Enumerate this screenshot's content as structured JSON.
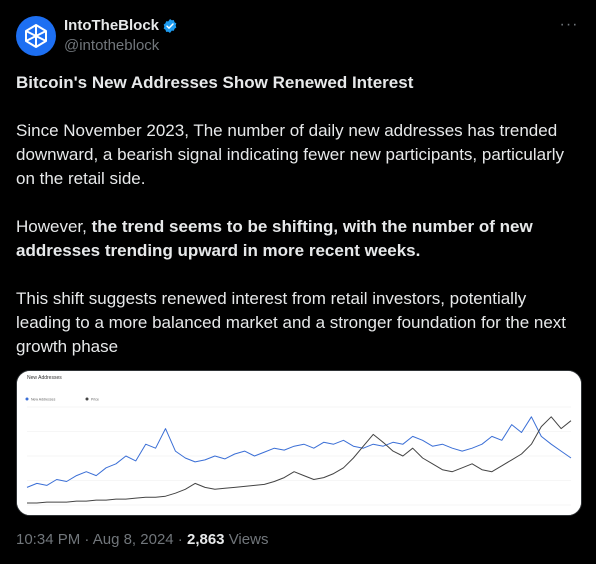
{
  "author": {
    "display_name": "IntoTheBlock",
    "handle": "@intotheblock",
    "verified_icon": "verified-badge-icon",
    "avatar_icon": "intotheblock-logo-icon"
  },
  "more_icon": "more-dots-icon",
  "post": {
    "title": "Bitcoin's New Addresses Show Renewed Interest",
    "paragraph1": "Since November 2023, The number of daily new addresses has trended downward, a bearish signal indicating fewer new participants, particularly on the retail side.",
    "paragraph2_prefix": "However, ",
    "paragraph2_bold": "the trend seems to be shifting, with the number of new addresses trending upward in more recent weeks.",
    "paragraph3": "This shift suggests renewed interest from retail investors, potentially leading to a more balanced market and a stronger foundation for the next growth phase"
  },
  "footer": {
    "time": "10:34 PM",
    "separator1": " · ",
    "date": "Aug 8, 2024",
    "separator2": " · ",
    "views_count": "2,863",
    "views_label": " Views"
  },
  "colors": {
    "background": "#000000",
    "text": "#e7e9ea",
    "muted": "#71767b",
    "accent": "#1d9bf0",
    "series_new_addresses": "#3b6fd6",
    "series_price": "#444444"
  },
  "chart_data": {
    "type": "line",
    "title": "New Addresses",
    "legend": [
      "New Addresses",
      "Price"
    ],
    "series": [
      {
        "name": "New Addresses",
        "values": [
          0.18,
          0.22,
          0.2,
          0.26,
          0.24,
          0.3,
          0.34,
          0.3,
          0.38,
          0.42,
          0.5,
          0.45,
          0.62,
          0.58,
          0.78,
          0.55,
          0.48,
          0.44,
          0.46,
          0.5,
          0.47,
          0.52,
          0.55,
          0.5,
          0.54,
          0.58,
          0.56,
          0.6,
          0.62,
          0.58,
          0.64,
          0.62,
          0.66,
          0.6,
          0.58,
          0.62,
          0.6,
          0.64,
          0.62,
          0.7,
          0.66,
          0.6,
          0.62,
          0.58,
          0.55,
          0.58,
          0.62,
          0.7,
          0.66,
          0.82,
          0.74,
          0.9,
          0.7,
          0.62,
          0.55,
          0.48
        ]
      },
      {
        "name": "Price",
        "values": [
          0.02,
          0.02,
          0.03,
          0.03,
          0.03,
          0.04,
          0.04,
          0.05,
          0.05,
          0.06,
          0.06,
          0.07,
          0.08,
          0.08,
          0.09,
          0.12,
          0.16,
          0.22,
          0.18,
          0.16,
          0.17,
          0.18,
          0.19,
          0.2,
          0.21,
          0.24,
          0.28,
          0.34,
          0.3,
          0.26,
          0.28,
          0.32,
          0.38,
          0.48,
          0.6,
          0.72,
          0.64,
          0.55,
          0.5,
          0.58,
          0.48,
          0.42,
          0.36,
          0.34,
          0.38,
          0.42,
          0.36,
          0.34,
          0.4,
          0.46,
          0.52,
          0.62,
          0.8,
          0.9,
          0.78,
          0.86
        ]
      }
    ]
  }
}
